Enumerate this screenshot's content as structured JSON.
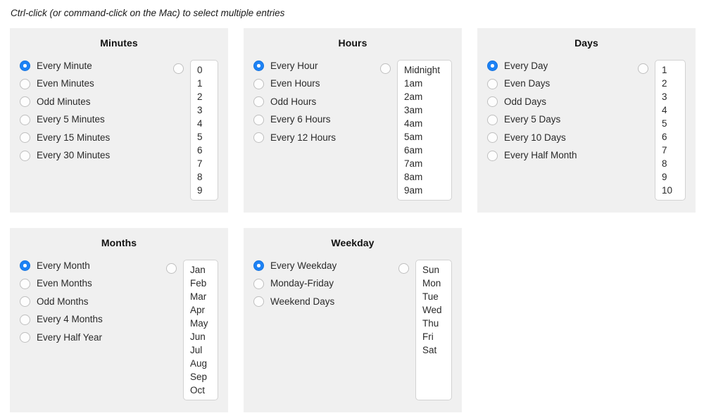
{
  "instruction": "Ctrl-click (or command-click on the Mac) to select multiple entries",
  "colors": {
    "accent": "#1d82f5",
    "panel_bg": "#f0f0f0",
    "page_bg": "#ffffff",
    "listbox_border": "#d2d2d2",
    "radio_border": "#bfbfbf",
    "text": "#2a2a2a"
  },
  "panels": [
    {
      "id": "minutes",
      "title": "Minutes",
      "options": [
        {
          "label": "Every Minute",
          "selected": true
        },
        {
          "label": "Even Minutes",
          "selected": false
        },
        {
          "label": "Odd Minutes",
          "selected": false
        },
        {
          "label": "Every 5 Minutes",
          "selected": false
        },
        {
          "label": "Every 15 Minutes",
          "selected": false
        },
        {
          "label": "Every 30 Minutes",
          "selected": false
        }
      ],
      "list_radio_selected": false,
      "list_items": [
        "0",
        "1",
        "2",
        "3",
        "4",
        "5",
        "6",
        "7",
        "8",
        "9"
      ]
    },
    {
      "id": "hours",
      "title": "Hours",
      "options": [
        {
          "label": "Every Hour",
          "selected": true
        },
        {
          "label": "Even Hours",
          "selected": false
        },
        {
          "label": "Odd Hours",
          "selected": false
        },
        {
          "label": "Every 6 Hours",
          "selected": false
        },
        {
          "label": "Every 12 Hours",
          "selected": false
        }
      ],
      "list_radio_selected": false,
      "list_items": [
        "Midnight",
        "1am",
        "2am",
        "3am",
        "4am",
        "5am",
        "6am",
        "7am",
        "8am",
        "9am"
      ]
    },
    {
      "id": "days",
      "title": "Days",
      "options": [
        {
          "label": "Every Day",
          "selected": true
        },
        {
          "label": "Even Days",
          "selected": false
        },
        {
          "label": "Odd Days",
          "selected": false
        },
        {
          "label": "Every 5 Days",
          "selected": false
        },
        {
          "label": "Every 10 Days",
          "selected": false
        },
        {
          "label": "Every Half Month",
          "selected": false
        }
      ],
      "list_radio_selected": false,
      "list_items": [
        "1",
        "2",
        "3",
        "4",
        "5",
        "6",
        "7",
        "8",
        "9",
        "10"
      ]
    },
    {
      "id": "months",
      "title": "Months",
      "options": [
        {
          "label": "Every Month",
          "selected": true
        },
        {
          "label": "Even Months",
          "selected": false
        },
        {
          "label": "Odd Months",
          "selected": false
        },
        {
          "label": "Every 4 Months",
          "selected": false
        },
        {
          "label": "Every Half Year",
          "selected": false
        }
      ],
      "list_radio_selected": false,
      "list_items": [
        "Jan",
        "Feb",
        "Mar",
        "Apr",
        "May",
        "Jun",
        "Jul",
        "Aug",
        "Sep",
        "Oct"
      ]
    },
    {
      "id": "weekday",
      "title": "Weekday",
      "options": [
        {
          "label": "Every Weekday",
          "selected": true
        },
        {
          "label": "Monday-Friday",
          "selected": false
        },
        {
          "label": "Weekend Days",
          "selected": false
        }
      ],
      "list_radio_selected": false,
      "list_items": [
        "Sun",
        "Mon",
        "Tue",
        "Wed",
        "Thu",
        "Fri",
        "Sat"
      ]
    }
  ]
}
